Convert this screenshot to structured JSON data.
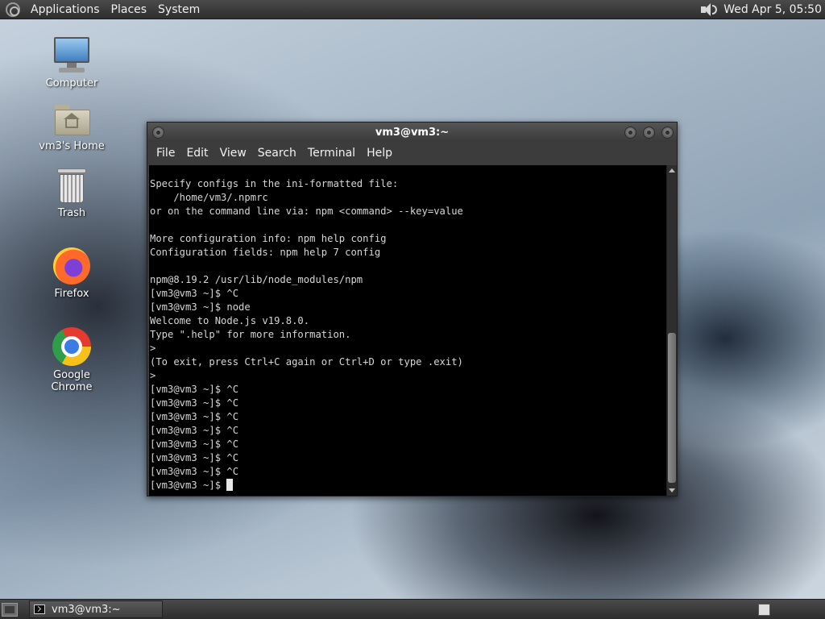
{
  "top_panel": {
    "menus": [
      "Applications",
      "Places",
      "System"
    ],
    "clock": "Wed Apr  5, 05:50"
  },
  "desktop_icons": [
    {
      "label": "Computer",
      "icon": "computer-icon"
    },
    {
      "label": "vm3's Home",
      "icon": "home-folder-icon"
    },
    {
      "label": "Trash",
      "icon": "trash-icon"
    },
    {
      "label": "Firefox",
      "icon": "firefox-icon"
    },
    {
      "label": "Google Chrome",
      "icon": "chrome-icon"
    }
  ],
  "terminal": {
    "title": "vm3@vm3:~",
    "menu": [
      "File",
      "Edit",
      "View",
      "Search",
      "Terminal",
      "Help"
    ],
    "lines": [
      "Specify configs in the ini-formatted file:",
      "    /home/vm3/.npmrc",
      "or on the command line via: npm <command> --key=value",
      "",
      "More configuration info: npm help config",
      "Configuration fields: npm help 7 config",
      "",
      "npm@8.19.2 /usr/lib/node_modules/npm",
      "[vm3@vm3 ~]$ ^C",
      "[vm3@vm3 ~]$ node",
      "Welcome to Node.js v19.8.0.",
      "Type \".help\" for more information.",
      ">",
      "(To exit, press Ctrl+C again or Ctrl+D or type .exit)",
      ">",
      "[vm3@vm3 ~]$ ^C",
      "[vm3@vm3 ~]$ ^C",
      "[vm3@vm3 ~]$ ^C",
      "[vm3@vm3 ~]$ ^C",
      "[vm3@vm3 ~]$ ^C",
      "[vm3@vm3 ~]$ ^C",
      "[vm3@vm3 ~]$ ^C"
    ],
    "prompt": "[vm3@vm3 ~]$ "
  },
  "bottom_panel": {
    "task_label": "vm3@vm3:~"
  }
}
